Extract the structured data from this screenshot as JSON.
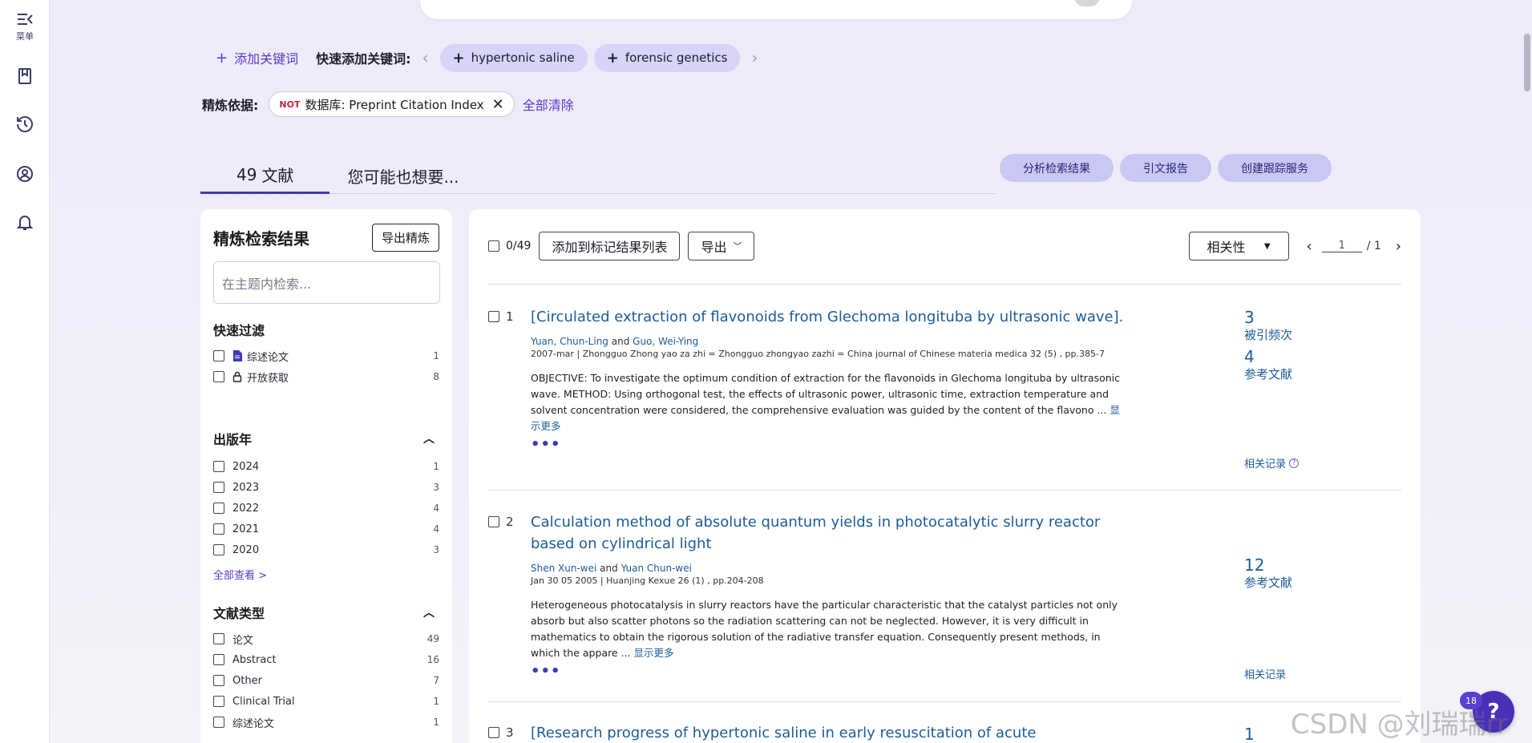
{
  "rail": {
    "menu_label": "菜单"
  },
  "keywords": {
    "add_label": "添加关键词",
    "quick_label": "快速添加关键词:",
    "chips": [
      "hypertonic saline",
      "forensic genetics"
    ]
  },
  "refine": {
    "label": "精炼依据:",
    "not_badge": "NOT",
    "filter_text": "数据库: Preprint Citation Index",
    "clear_all": "全部清除"
  },
  "tabs": {
    "count": "49",
    "docs_label": "文献",
    "maybe_label": "您可能也想要..."
  },
  "actions": [
    "分析检索结果",
    "引文报告",
    "创建跟踪服务"
  ],
  "side": {
    "title": "精炼检索结果",
    "export_btn": "导出精炼",
    "search_placeholder": "在主题内检索...",
    "quick_filter_title": "快速过滤",
    "quick_filters": [
      {
        "label": "综述论文",
        "count": "1",
        "icon": "document-icon"
      },
      {
        "label": "开放获取",
        "count": "8",
        "icon": "lock-icon"
      }
    ],
    "year_title": "出版年",
    "years": [
      {
        "label": "2024",
        "count": "1"
      },
      {
        "label": "2023",
        "count": "3"
      },
      {
        "label": "2022",
        "count": "4"
      },
      {
        "label": "2021",
        "count": "4"
      },
      {
        "label": "2020",
        "count": "3"
      }
    ],
    "see_all": "全部查看 >",
    "doctype_title": "文献类型",
    "doctypes": [
      {
        "label": "论文",
        "count": "49"
      },
      {
        "label": "Abstract",
        "count": "16"
      },
      {
        "label": "Other",
        "count": "7"
      },
      {
        "label": "Clinical Trial",
        "count": "1"
      },
      {
        "label": "综述论文",
        "count": "1"
      }
    ]
  },
  "toolbar": {
    "selected": "0/49",
    "add_marked": "添加到标记结果列表",
    "export": "导出",
    "sort": "相关性",
    "page_current": "1",
    "page_total": "/ 1"
  },
  "records": [
    {
      "num": "1",
      "title": "[Circulated extraction of flavonoids from Glechoma longituba by ultrasonic wave].",
      "author1": "Yuan, Chun-Ling",
      "and": "and",
      "author2": "Guo, Wei-Ying",
      "date": "2007-mar",
      "source": "Zhongguo Zhong yao za zhi = Zhongguo zhongyao zazhi = China journal of Chinese materia medica 32 (5) , pp.385-7",
      "abstract": "OBJECTIVE: To investigate the optimum condition of extraction for the flavonoids in Glechoma longituba by ultrasonic wave. METHOD: Using orthogonal test, the effects of ultrasonic power, ultrasonic time, extraction temperature and solvent concentration were considered, the comprehensive evaluation was guided by the content of the flavono ...",
      "show_more": "显示更多",
      "cited_num": "3",
      "cited_label": "被引频次",
      "refs_num": "4",
      "refs_label": "参考文献",
      "related": "相关记录"
    },
    {
      "num": "2",
      "title": "Calculation method of absolute quantum yields in photocatalytic slurry reactor based on cylindrical light",
      "author1": "Shen Xun-wei",
      "and": "and",
      "author2": "Yuan Chun-wei",
      "date": "Jan 30 05 2005",
      "source": "Huanjing Kexue 26 (1) , pp.204-208",
      "abstract": "Heterogeneous photocatalysis in slurry reactors have the particular characteristic that the catalyst particles not only absorb but also scatter photons so the radiation scattering can not be neglected. However, it is very difficult in mathematics to obtain the rigorous solution of the radiative transfer equation. Consequently present methods, in which the appare ...",
      "show_more": "显示更多",
      "refs_num": "12",
      "refs_label": "参考文献",
      "related": "相关记录"
    },
    {
      "num": "3",
      "title": "[Research progress of hypertonic saline in early resuscitation of acute pancreatitis].",
      "cited_num": "1"
    }
  ],
  "help": {
    "badge": "18",
    "glyph": "?"
  },
  "watermark": "CSDN @刘瑞瑞rr"
}
